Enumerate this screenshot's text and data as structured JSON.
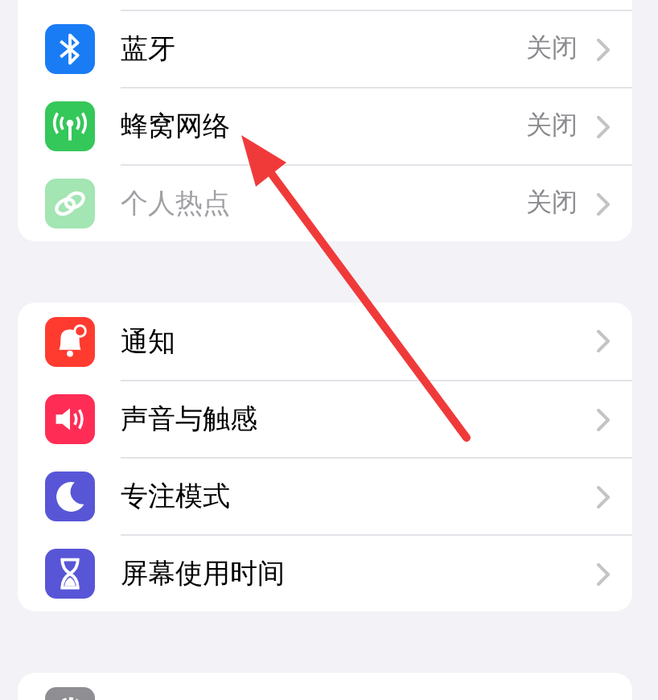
{
  "groups": [
    {
      "rows": [
        {
          "kind": "bluetooth",
          "label": "蓝牙",
          "value": "关闭",
          "disabled": false
        },
        {
          "kind": "antenna",
          "label": "蜂窝网络",
          "value": "关闭",
          "disabled": false
        },
        {
          "kind": "chain",
          "label": "个人热点",
          "value": "关闭",
          "disabled": true
        }
      ]
    },
    {
      "rows": [
        {
          "kind": "bell",
          "label": "通知",
          "disabled": false
        },
        {
          "kind": "speaker",
          "label": "声音与触感",
          "disabled": false
        },
        {
          "kind": "moon",
          "label": "专注模式",
          "disabled": false
        },
        {
          "kind": "hourglass",
          "label": "屏幕使用时间",
          "disabled": false
        }
      ]
    },
    {
      "rows": [
        {
          "kind": "gear",
          "disabled": false
        }
      ]
    }
  ]
}
